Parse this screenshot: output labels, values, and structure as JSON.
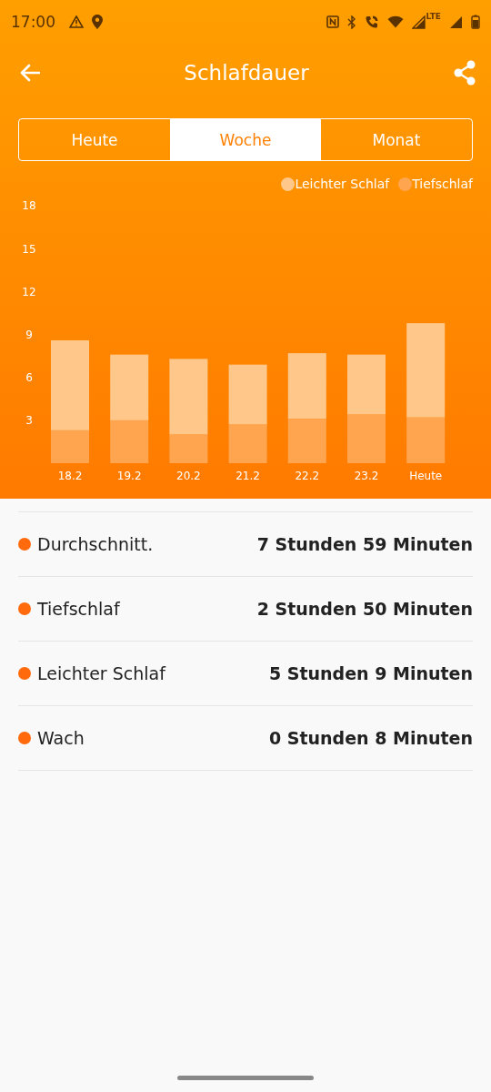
{
  "status_bar": {
    "time": "17:00",
    "network_label": "LTE"
  },
  "header": {
    "title": "Schlafdauer"
  },
  "tabs": [
    {
      "label": "Heute",
      "selected": false
    },
    {
      "label": "Woche",
      "selected": true
    },
    {
      "label": "Monat",
      "selected": false
    }
  ],
  "chart_data": {
    "type": "bar",
    "stacked": true,
    "categories": [
      "18.2",
      "19.2",
      "20.2",
      "21.2",
      "22.2",
      "23.2",
      "Heute"
    ],
    "ylim": [
      0,
      18
    ],
    "yticks": [
      3,
      6,
      9,
      12,
      15,
      18
    ],
    "series": [
      {
        "name": "Leichter Schlaf",
        "color": "#ffc78a",
        "values": [
          6.3,
          4.6,
          5.3,
          4.2,
          4.6,
          4.2,
          6.6
        ]
      },
      {
        "name": "Tiefschlaf",
        "color": "#ffa54f",
        "values": [
          2.3,
          3.0,
          2.0,
          2.7,
          3.1,
          3.4,
          3.2
        ]
      }
    ]
  },
  "stats": [
    {
      "label": "Durchschnitt.",
      "value": "7 Stunden 59 Minuten"
    },
    {
      "label": "Tiefschlaf",
      "value": "2 Stunden 50 Minuten"
    },
    {
      "label": "Leichter Schlaf",
      "value": "5 Stunden 9 Minuten"
    },
    {
      "label": "Wach",
      "value": "0 Stunden 8 Minuten"
    }
  ]
}
